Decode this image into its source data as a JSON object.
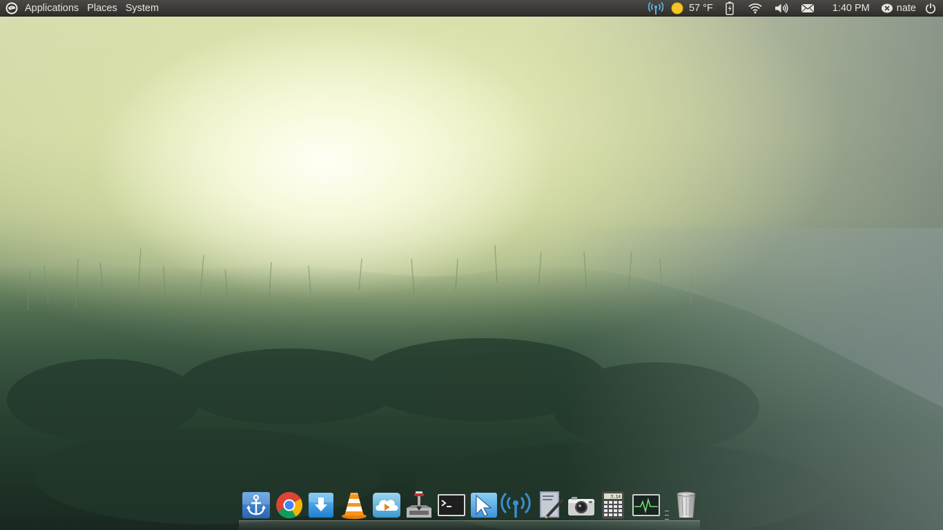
{
  "top_panel": {
    "menus": [
      "Applications",
      "Places",
      "System"
    ],
    "weather": {
      "temperature": "57 °F",
      "icon": "sun-icon"
    },
    "clock": "1:40 PM",
    "user": "nate",
    "indicators": [
      "network-broadcast-icon",
      "weather-sun-icon",
      "battery-icon",
      "wifi-icon",
      "volume-icon",
      "mail-icon",
      "user-status-icon",
      "power-icon"
    ]
  },
  "dock": {
    "items": [
      {
        "name": "anchor",
        "icon": "anchor-icon"
      },
      {
        "name": "chrome",
        "icon": "chrome-icon"
      },
      {
        "name": "downloader",
        "icon": "download-arrow-icon"
      },
      {
        "name": "vlc",
        "icon": "vlc-cone-icon"
      },
      {
        "name": "cloud-player",
        "icon": "cloud-play-icon"
      },
      {
        "name": "installer",
        "icon": "installer-icon"
      },
      {
        "name": "terminal",
        "icon": "terminal-icon"
      },
      {
        "name": "pointer",
        "icon": "cursor-icon"
      },
      {
        "name": "network-broadcast",
        "icon": "broadcast-icon"
      },
      {
        "name": "text-editor",
        "icon": "pen-document-icon"
      },
      {
        "name": "camera",
        "icon": "camera-icon"
      },
      {
        "name": "calculator",
        "icon": "calculator-icon"
      },
      {
        "name": "system-monitor",
        "icon": "monitor-pulse-icon"
      },
      {
        "name": "trash",
        "icon": "trash-icon"
      }
    ],
    "calculator_display": "3.14"
  },
  "colors": {
    "panel_bg": "#3c3b37",
    "panel_text": "#e8e6e1",
    "indicator_blue": "#5bb5e8",
    "sun_yellow": "#f6c624"
  }
}
